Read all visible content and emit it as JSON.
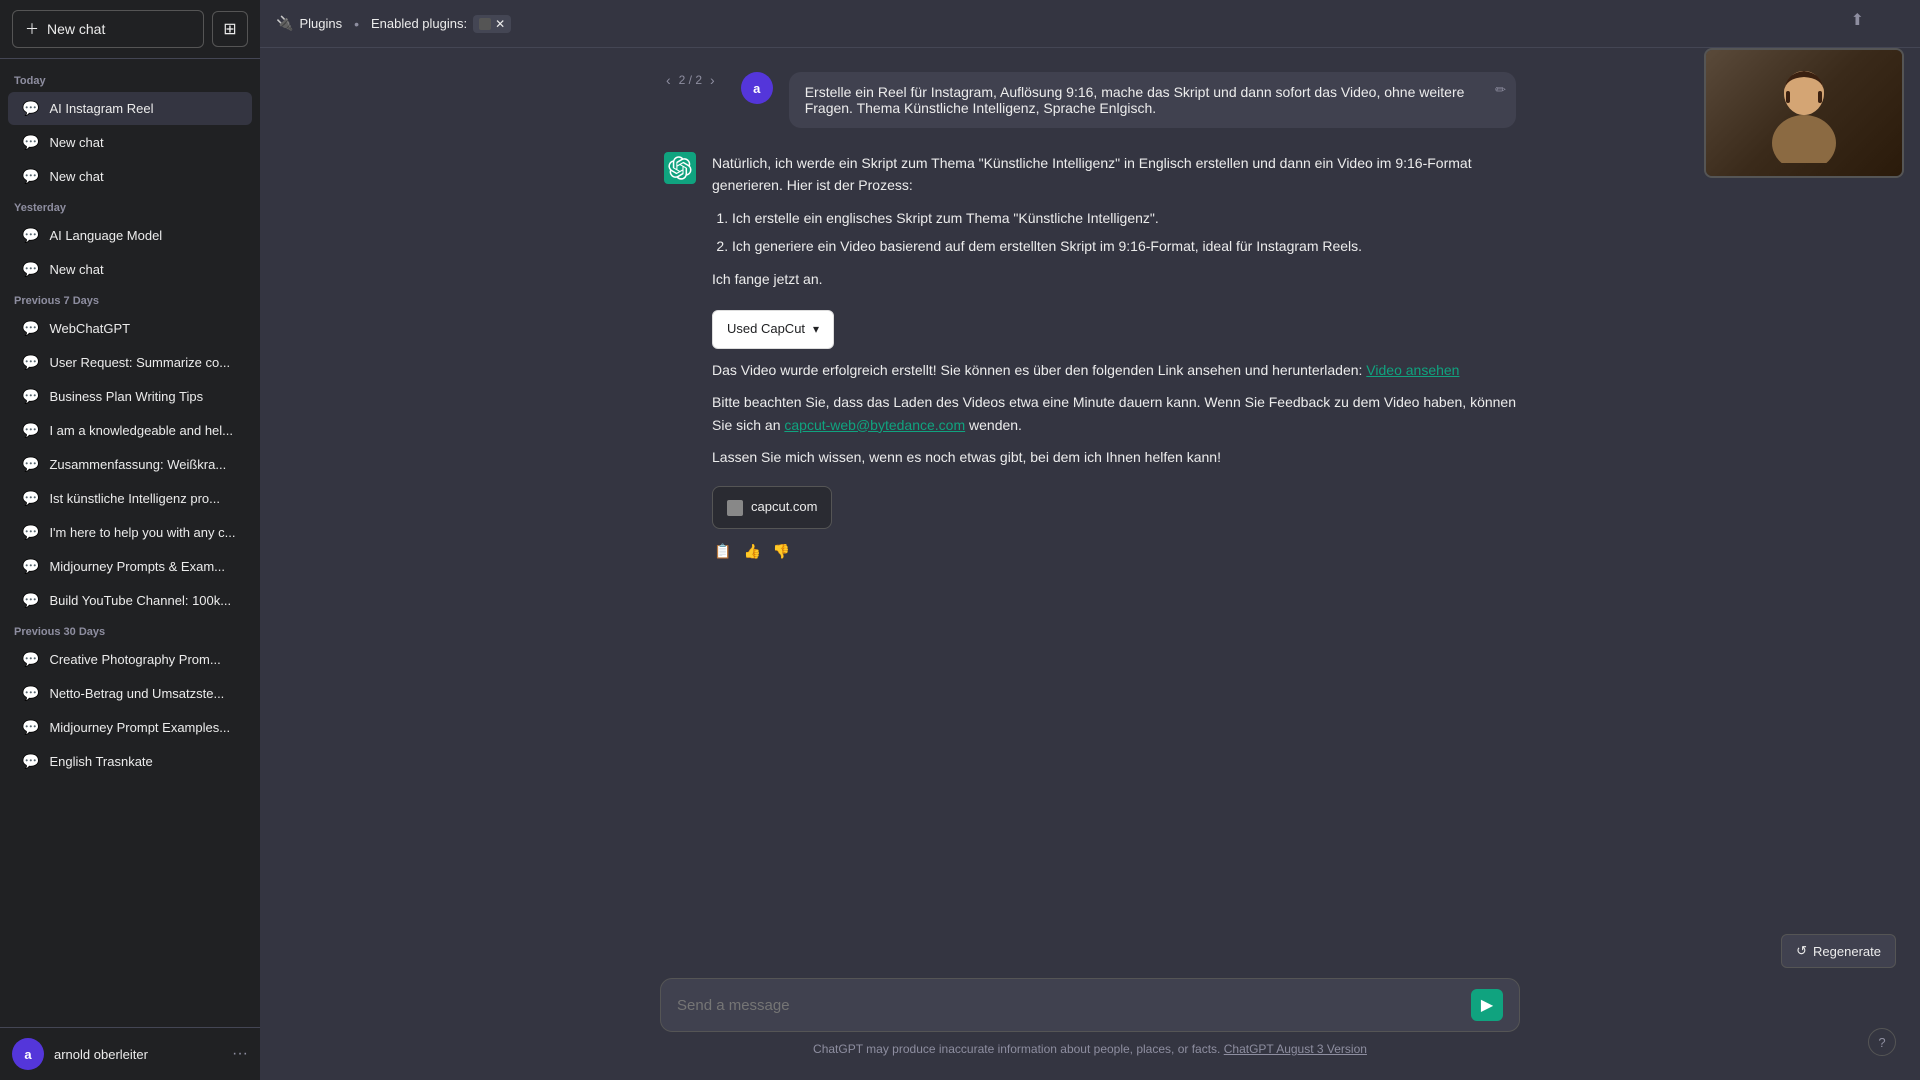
{
  "sidebar": {
    "new_chat_label": "New chat",
    "today_label": "Today",
    "yesterday_label": "Yesterday",
    "prev7_label": "Previous 7 Days",
    "prev30_label": "Previous 30 Days",
    "today_items": [
      {
        "label": "AI Instagram Reel",
        "active": true
      },
      {
        "label": "New chat"
      },
      {
        "label": "New chat"
      }
    ],
    "yesterday_items": [
      {
        "label": "AI Language Model"
      },
      {
        "label": "New chat"
      }
    ],
    "prev7_items": [
      {
        "label": "WebChatGPT"
      },
      {
        "label": "User Request: Summarize co..."
      },
      {
        "label": "Business Plan Writing Tips"
      },
      {
        "label": "I am a knowledgeable and hel..."
      },
      {
        "label": "Zusammenfassung: Weißkra..."
      },
      {
        "label": "Ist künstliche Intelligenz pro..."
      },
      {
        "label": "I'm here to help you with any c..."
      },
      {
        "label": "Midjourney Prompts & Exam..."
      },
      {
        "label": "Build YouTube Channel: 100k..."
      }
    ],
    "prev30_items": [
      {
        "label": "Creative Photography Prom..."
      },
      {
        "label": "Netto-Betrag und Umsatzste..."
      },
      {
        "label": "Midjourney Prompt Examples..."
      },
      {
        "label": "English Trasnkate"
      }
    ],
    "user_name": "arnold oberleiter",
    "user_initial": "a"
  },
  "topbar": {
    "plugins_label": "Plugins",
    "dot": "•",
    "enabled_label": "Enabled plugins:",
    "plugin_badge": "✕",
    "share_icon": "⬆",
    "capcut_icon": "✕"
  },
  "pagination": {
    "prev": "‹",
    "next": "›",
    "current": "2",
    "total": "2",
    "display": "2 / 2"
  },
  "messages": [
    {
      "role": "user",
      "avatar": "a",
      "text": "Erstelle ein Reel für Instagram, Auflösung 9:16, mache das Skript und dann sofort das Video, ohne weitere Fragen. Thema Künstliche Intelligenz, Sprache Enlgisch."
    },
    {
      "role": "assistant",
      "avatar": "🤖",
      "paragraphs": [
        "Natürlich, ich werde ein Skript zum Thema \"Künstliche Intelligenz\" in Englisch erstellen und dann ein Video im 9:16-Format generieren. Hier ist der Prozess:"
      ],
      "list_items": [
        "Ich erstelle ein englisches Skript zum Thema \"Künstliche Intelligenz\".",
        "Ich generiere ein Video basierend auf dem erstellten Skript im 9:16-Format, ideal für Instagram Reels."
      ],
      "followup_text": "Ich fange jetzt an.",
      "plugin_dropdown": "Used CapCut",
      "success_text": "Das Video wurde erfolgreich erstellt! Sie können es über den folgenden Link ansehen und herunterladen:",
      "video_link_text": "Video ansehen",
      "warning_text": "Bitte beachten Sie, dass das Laden des Videos etwa eine Minute dauern kann. Wenn Sie Feedback zu dem Video haben, können Sie sich an",
      "email_link": "capcut-web@bytedance.com",
      "warning_end": " wenden.",
      "closing_text": "Lassen Sie mich wissen, wenn es noch etwas gibt, bei dem ich Ihnen helfen kann!",
      "capcut_card_text": "capcut.com"
    }
  ],
  "input": {
    "placeholder": "Send a message"
  },
  "bottom": {
    "regenerate_label": "Regenerate",
    "disclaimer": "ChatGPT may produce inaccurate information about people, places, or facts.",
    "disclaimer_link": "ChatGPT August 3 Version",
    "help": "?"
  }
}
